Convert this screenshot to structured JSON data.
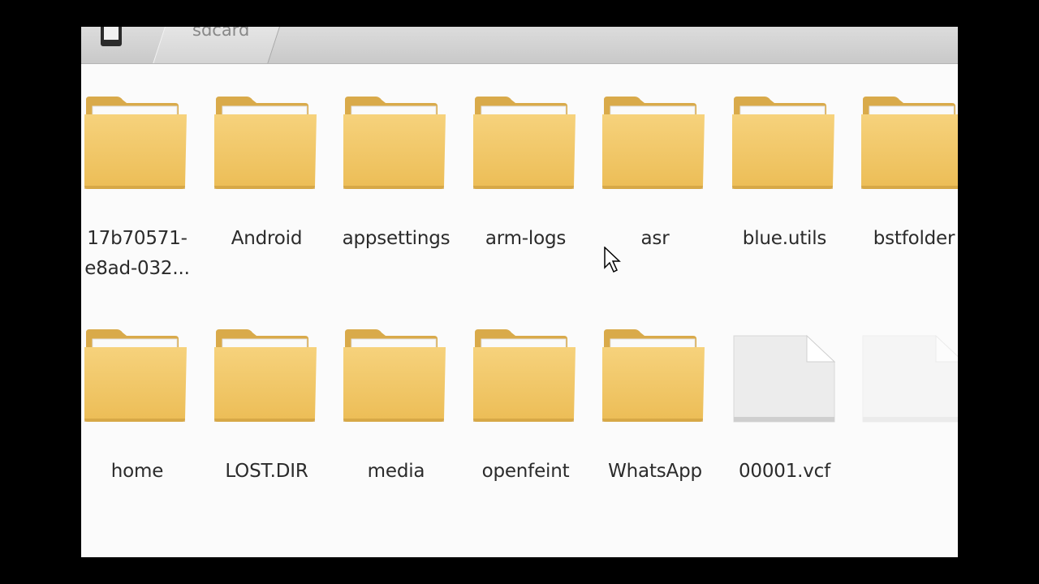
{
  "breadcrumb": {
    "device_icon": "phone-icon",
    "current": "sdcard"
  },
  "files": [
    {
      "name": "17b70571-\ne8ad-032...",
      "type": "folder",
      "icon": "folder-icon"
    },
    {
      "name": "Android",
      "type": "folder",
      "icon": "folder-icon"
    },
    {
      "name": "appsettings",
      "type": "folder",
      "icon": "folder-icon"
    },
    {
      "name": "arm-logs",
      "type": "folder",
      "icon": "folder-icon"
    },
    {
      "name": "asr",
      "type": "folder",
      "icon": "folder-icon"
    },
    {
      "name": "blue.utils",
      "type": "folder",
      "icon": "folder-icon"
    },
    {
      "name": "bstfolder",
      "type": "folder",
      "icon": "folder-icon"
    },
    {
      "name": "home",
      "type": "folder",
      "icon": "folder-icon"
    },
    {
      "name": "LOST.DIR",
      "type": "folder",
      "icon": "folder-icon"
    },
    {
      "name": "media",
      "type": "folder",
      "icon": "folder-icon"
    },
    {
      "name": "openfeint",
      "type": "folder",
      "icon": "folder-icon"
    },
    {
      "name": "WhatsApp",
      "type": "folder",
      "icon": "folder-icon"
    },
    {
      "name": "00001.vcf",
      "type": "file",
      "icon": "file-icon"
    },
    {
      "name": "",
      "type": "file",
      "icon": "file-icon"
    }
  ],
  "colors": {
    "folder_body": "#f2c766",
    "folder_back": "#e0b14f",
    "background": "#fbfbfb"
  }
}
